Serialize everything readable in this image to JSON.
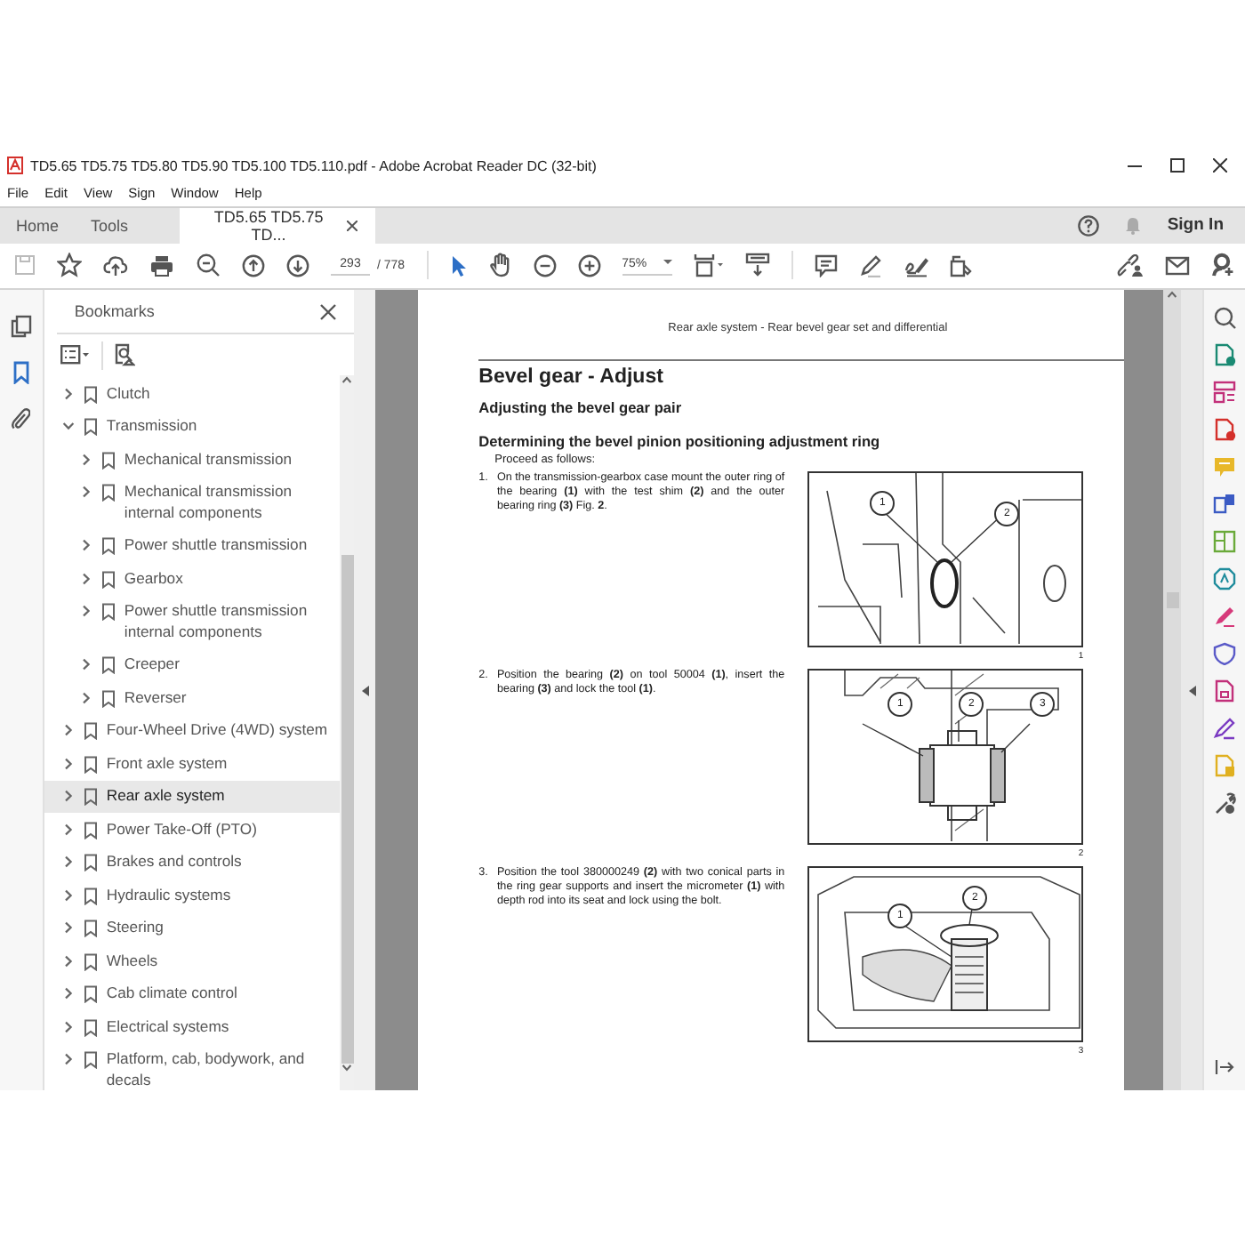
{
  "window": {
    "title": "TD5.65 TD5.75 TD5.80 TD5.90 TD5.100 TD5.110.pdf - Adobe Acrobat Reader DC (32-bit)"
  },
  "menu": [
    "File",
    "Edit",
    "View",
    "Sign",
    "Window",
    "Help"
  ],
  "tabs": [
    {
      "label": "Home",
      "selected": false
    },
    {
      "label": "Tools",
      "selected": false
    },
    {
      "label": "TD5.65 TD5.75 TD...",
      "selected": true
    }
  ],
  "account": {
    "sign_in": "Sign In"
  },
  "toolbar": {
    "page": "293",
    "page_count": "/ 778",
    "zoom": "75%"
  },
  "bookmarks": {
    "title": "Bookmarks",
    "items": [
      {
        "label": "Clutch",
        "expanded": false,
        "selected": false
      },
      {
        "label": "Transmission",
        "expanded": true,
        "selected": false,
        "children": [
          {
            "label": "Mechanical transmission",
            "expanded": false,
            "selected": false
          },
          {
            "label": "Mechanical transmission internal components",
            "expanded": false,
            "selected": false
          },
          {
            "label": "Power shuttle transmission",
            "expanded": false,
            "selected": false
          },
          {
            "label": "Gearbox",
            "expanded": false,
            "selected": false
          },
          {
            "label": "Power shuttle transmission internal components",
            "expanded": false,
            "selected": false
          },
          {
            "label": "Creeper",
            "expanded": false,
            "selected": false
          },
          {
            "label": "Reverser",
            "expanded": false,
            "selected": false
          }
        ]
      },
      {
        "label": "Four-Wheel Drive (4WD) system",
        "expanded": false,
        "selected": false
      },
      {
        "label": "Front axle system",
        "expanded": false,
        "selected": false
      },
      {
        "label": "Rear axle system",
        "expanded": false,
        "selected": true
      },
      {
        "label": "Power Take-Off (PTO)",
        "expanded": false,
        "selected": false
      },
      {
        "label": "Brakes and controls",
        "expanded": false,
        "selected": false
      },
      {
        "label": "Hydraulic systems",
        "expanded": false,
        "selected": false
      },
      {
        "label": "Steering",
        "expanded": false,
        "selected": false
      },
      {
        "label": "Wheels",
        "expanded": false,
        "selected": false
      },
      {
        "label": "Cab climate control",
        "expanded": false,
        "selected": false
      },
      {
        "label": "Electrical systems",
        "expanded": false,
        "selected": false
      },
      {
        "label": "Platform, cab, bodywork, and decals",
        "expanded": false,
        "selected": false
      }
    ]
  },
  "document": {
    "running_header": "Rear axle system - Rear bevel gear set and differential",
    "title": "Bevel gear - Adjust",
    "subtitle": "Adjusting the bevel gear pair",
    "section": "Determining the bevel pinion positioning adjustment ring",
    "intro": "Proceed as follows:",
    "steps": [
      {
        "number": "1.",
        "text": "On the transmission-gearbox case mount the outer ring of the bearing **(1)** with the test shim **(2)** and the outer bearing ring **(3)** Fig. **2**.",
        "figure": {
          "number": "1",
          "callouts": [
            "1",
            "2"
          ]
        }
      },
      {
        "number": "2.",
        "text": "Position the bearing **(2)** on tool 50004 **(1)**, insert the bearing **(3)** and lock the tool **(1)**.",
        "figure": {
          "number": "2",
          "callouts": [
            "1",
            "2",
            "3"
          ]
        }
      },
      {
        "number": "3.",
        "text": "Position the tool 380000249 **(2)** with two conical parts in the ring gear supports and insert the micrometer **(1)** with depth rod into its seat and lock using the bolt.",
        "figure": {
          "number": "3",
          "callouts": [
            "1",
            "2"
          ]
        }
      }
    ]
  }
}
